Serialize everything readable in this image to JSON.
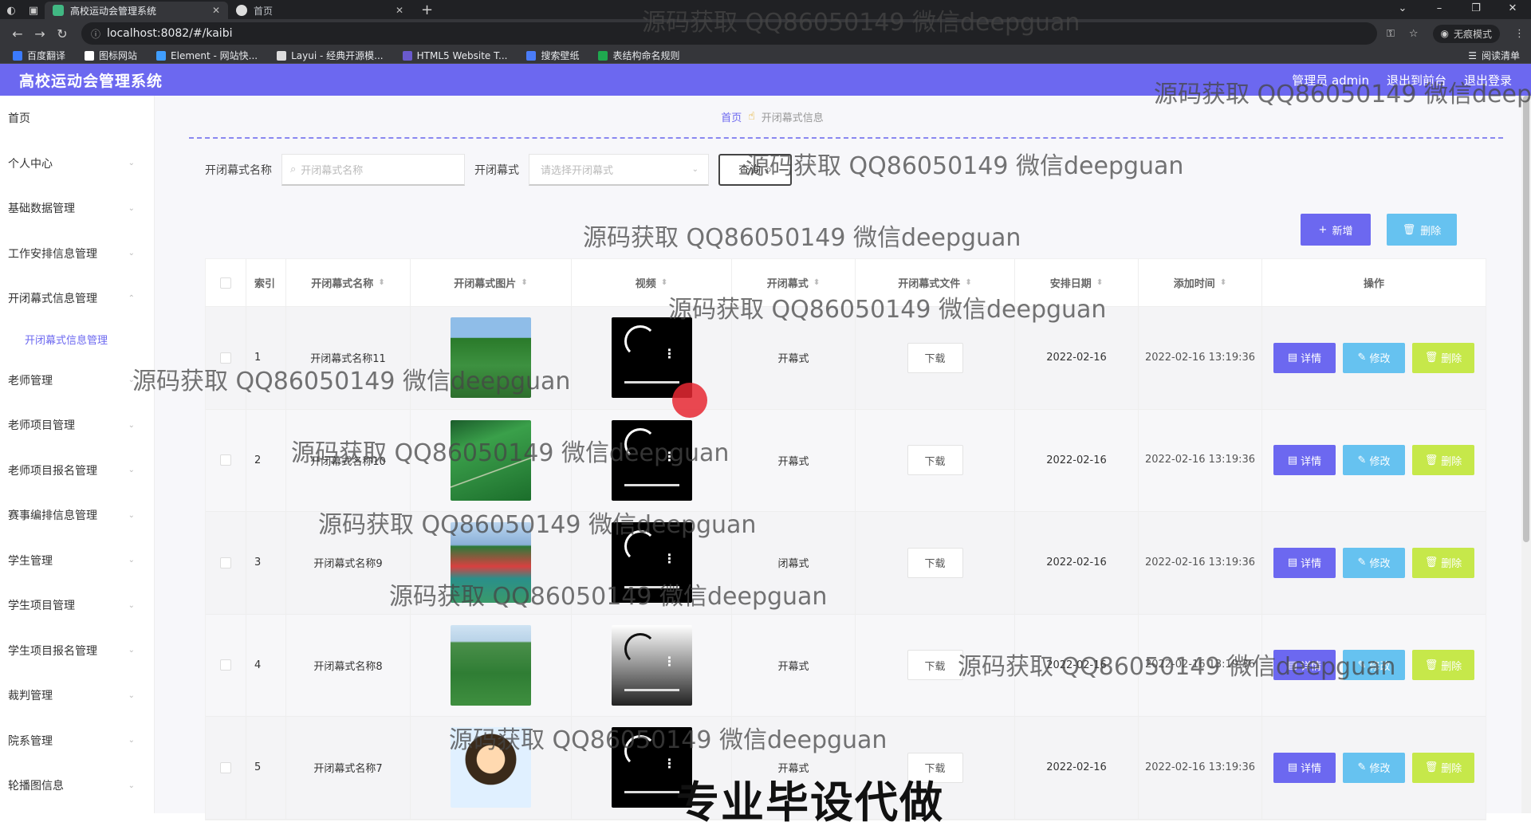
{
  "browser": {
    "tabs": [
      {
        "label": "高校运动会管理系统",
        "active": true
      },
      {
        "label": "首页",
        "active": false
      }
    ],
    "url": "localhost:8082/#/kaibi",
    "incognito_label": "无痕模式",
    "bookmarks": [
      "百度翻译",
      "图标网站",
      "Element - 网站快...",
      "Layui - 经典开源模...",
      "HTML5 Website T...",
      "搜索壁纸",
      "表结构命名规则"
    ],
    "reading_list": "阅读清单"
  },
  "watermarks": {
    "text": "源码获取 QQ86050149 微信deepguan",
    "partial": "源码获取 QQ86050149 微信deepg",
    "big": "专业毕设代做"
  },
  "header": {
    "title": "高校运动会管理系统",
    "user": "管理员 admin",
    "exit_to_front": "退出到前台",
    "logout": "退出登录"
  },
  "sidebar": {
    "items": [
      {
        "label": "首页",
        "chevron": false
      },
      {
        "label": "个人中心",
        "chevron": true
      },
      {
        "label": "基础数据管理",
        "chevron": true
      },
      {
        "label": "工作安排信息管理",
        "chevron": true
      },
      {
        "label": "开闭幕式信息管理",
        "chevron": true
      },
      {
        "label": "开闭幕式信息管理",
        "sub": true
      },
      {
        "label": "老师管理",
        "chevron": true
      },
      {
        "label": "老师项目管理",
        "chevron": true
      },
      {
        "label": "老师项目报名管理",
        "chevron": true
      },
      {
        "label": "赛事编排信息管理",
        "chevron": true
      },
      {
        "label": "学生管理",
        "chevron": true
      },
      {
        "label": "学生项目管理",
        "chevron": true
      },
      {
        "label": "学生项目报名管理",
        "chevron": true
      },
      {
        "label": "裁判管理",
        "chevron": true
      },
      {
        "label": "院系管理",
        "chevron": true
      },
      {
        "label": "轮播图信息",
        "chevron": true
      }
    ]
  },
  "breadcrumb": {
    "home": "首页",
    "current": "开闭幕式信息"
  },
  "search": {
    "name_label": "开闭幕式名称",
    "name_placeholder": "开闭幕式名称",
    "type_label": "开闭幕式",
    "type_placeholder": "请选择开闭幕式",
    "query_label": "查询"
  },
  "actions": {
    "add": "新增",
    "delete": "删除"
  },
  "table": {
    "columns": [
      "索引",
      "开闭幕式名称",
      "开闭幕式图片",
      "视频",
      "开闭幕式",
      "开闭幕式文件",
      "安排日期",
      "添加时间",
      "操作"
    ],
    "rows": [
      {
        "index": "1",
        "name": "开闭幕式名称11",
        "type": "开幕式",
        "file_btn": "下载",
        "date": "2022-02-16",
        "added": "2022-02-16 13:19:36",
        "thumb": "t1",
        "video": "dark"
      },
      {
        "index": "2",
        "name": "开闭幕式名称10",
        "type": "开幕式",
        "file_btn": "下载",
        "date": "2022-02-16",
        "added": "2022-02-16 13:19:36",
        "thumb": "t2",
        "video": "dark"
      },
      {
        "index": "3",
        "name": "开闭幕式名称9",
        "type": "闭幕式",
        "file_btn": "下载",
        "date": "2022-02-16",
        "added": "2022-02-16 13:19:36",
        "thumb": "t3",
        "video": "dark"
      },
      {
        "index": "4",
        "name": "开闭幕式名称8",
        "type": "开幕式",
        "file_btn": "下载",
        "date": "2022-02-16",
        "added": "2022-02-16 13:19:36",
        "thumb": "t4",
        "video": "light"
      },
      {
        "index": "5",
        "name": "开闭幕式名称7",
        "type": "开幕式",
        "file_btn": "下载",
        "date": "2022-02-16",
        "added": "2022-02-16 13:19:36",
        "thumb": "t5",
        "video": "dark"
      }
    ],
    "op_detail": "详情",
    "op_edit": "修改",
    "op_delete": "删除"
  },
  "colors": {
    "primary": "#6c68f0",
    "info": "#66c2f0",
    "danger_lime": "#c6e84a"
  }
}
